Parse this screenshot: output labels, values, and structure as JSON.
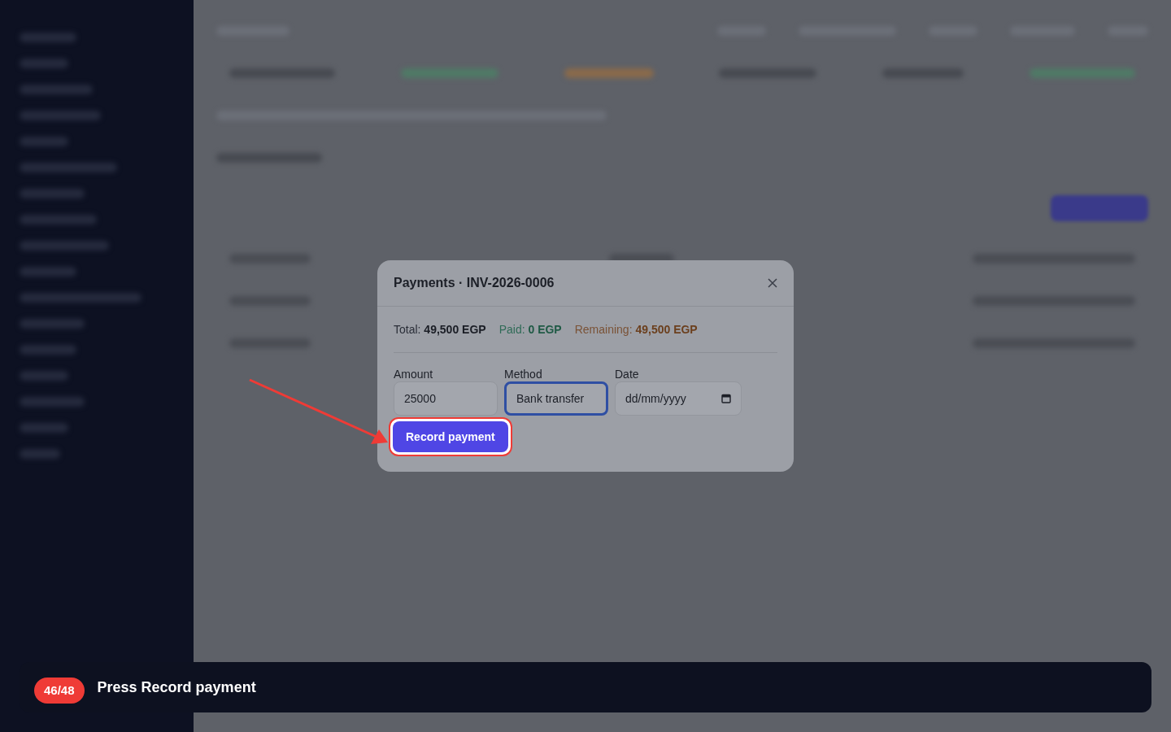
{
  "dialog": {
    "title": "Payments · INV-2026-0006",
    "summary": [
      {
        "kind": "total",
        "label": "Total:",
        "value": "49,500 EGP"
      },
      {
        "kind": "paid",
        "label": "Paid:",
        "value": "0 EGP"
      },
      {
        "kind": "remaining",
        "label": "Remaining:",
        "value": "49,500 EGP"
      }
    ],
    "fields": [
      {
        "kind": "text",
        "label": "Amount",
        "value": "25000",
        "focused": false
      },
      {
        "kind": "select",
        "label": "Method",
        "value": "Bank transfer",
        "focused": true
      },
      {
        "kind": "date",
        "label": "Date",
        "placeholder": "dd/mm/yyyy",
        "focused": false
      }
    ],
    "submit": {
      "label": "Record payment",
      "highlighted": true
    }
  },
  "tour": {
    "step": "46/48",
    "instruction": "Press Record payment"
  }
}
